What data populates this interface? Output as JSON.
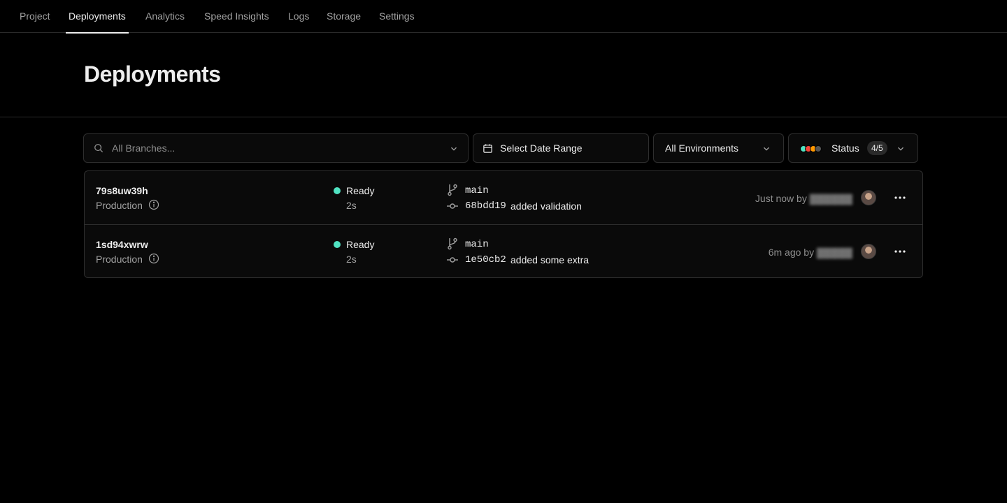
{
  "nav": {
    "tabs": [
      {
        "label": "Project"
      },
      {
        "label": "Deployments",
        "active": true
      },
      {
        "label": "Analytics"
      },
      {
        "label": "Speed Insights"
      },
      {
        "label": "Logs"
      },
      {
        "label": "Storage"
      },
      {
        "label": "Settings"
      }
    ]
  },
  "header": {
    "title": "Deployments"
  },
  "filters": {
    "branches_placeholder": "All Branches...",
    "date_range_label": "Select Date Range",
    "environment_label": "All Environments",
    "status_label": "Status",
    "status_count": "4/5",
    "status_dot_colors": [
      "#50e3c2",
      "#f44336",
      "#ff9800",
      "#555555"
    ]
  },
  "deployments": [
    {
      "id": "79s8uw39h",
      "environment": "Production",
      "status": "Ready",
      "status_color": "#50e3c2",
      "duration": "2s",
      "branch": "main",
      "commit_sha": "68bdd19",
      "commit_message": "added validation",
      "time": "Just now by",
      "author": "​"
    },
    {
      "id": "1sd94xwrw",
      "environment": "Production",
      "status": "Ready",
      "status_color": "#50e3c2",
      "duration": "2s",
      "branch": "main",
      "commit_sha": "1e50cb2",
      "commit_message": "added some extra",
      "time": "6m ago by",
      "author": "​"
    }
  ],
  "icons": {
    "search": "search-icon",
    "calendar": "calendar-icon",
    "chevron": "chevron-down-icon",
    "info": "info-icon",
    "branch": "git-branch-icon",
    "commit": "git-commit-icon",
    "more": "more-horizontal-icon"
  }
}
